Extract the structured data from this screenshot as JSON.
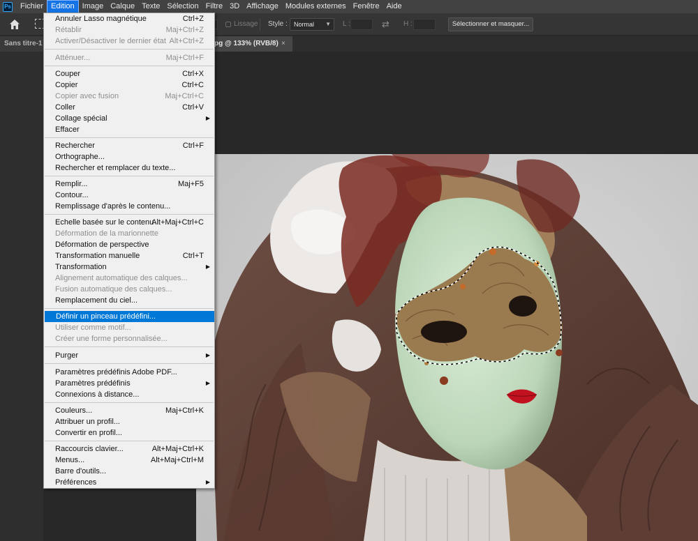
{
  "menubar": {
    "logo": "Ps",
    "items": [
      "Fichier",
      "Edition",
      "Image",
      "Calque",
      "Texte",
      "Sélection",
      "Filtre",
      "3D",
      "Affichage",
      "Modules externes",
      "Fenêtre",
      "Aide"
    ],
    "active": "Edition"
  },
  "options": {
    "lissage_label": "Lissage",
    "style_label": "Style :",
    "style_value": "Normal",
    "width_label": "L :",
    "height_label": "H :",
    "select_mask_button": "Sélectionner et masquer..."
  },
  "tabs": {
    "tab1": "Sans titre-1 @",
    "tab2": "pg @ 133% (RVB/8)",
    "close": "×"
  },
  "edit_menu": {
    "undo": {
      "label": "Annuler Lasso magnétique",
      "shortcut": "Ctrl+Z"
    },
    "redo": {
      "label": "Rétablir",
      "shortcut": "Maj+Ctrl+Z"
    },
    "toggle_last": {
      "label": "Activer/Désactiver le dernier état",
      "shortcut": "Alt+Ctrl+Z"
    },
    "fade": {
      "label": "Atténuer...",
      "shortcut": "Maj+Ctrl+F"
    },
    "cut": {
      "label": "Couper",
      "shortcut": "Ctrl+X"
    },
    "copy": {
      "label": "Copier",
      "shortcut": "Ctrl+C"
    },
    "copy_merged": {
      "label": "Copier avec fusion",
      "shortcut": "Maj+Ctrl+C"
    },
    "paste": {
      "label": "Coller",
      "shortcut": "Ctrl+V"
    },
    "paste_special": {
      "label": "Collage spécial"
    },
    "clear": {
      "label": "Effacer"
    },
    "search": {
      "label": "Rechercher",
      "shortcut": "Ctrl+F"
    },
    "spelling": {
      "label": "Orthographe..."
    },
    "find_replace": {
      "label": "Rechercher et remplacer du texte..."
    },
    "fill": {
      "label": "Remplir...",
      "shortcut": "Maj+F5"
    },
    "stroke": {
      "label": "Contour..."
    },
    "content_aware_fill": {
      "label": "Remplissage d'après le contenu..."
    },
    "content_aware_scale": {
      "label": "Echelle basée sur le contenu",
      "shortcut": "Alt+Maj+Ctrl+C"
    },
    "puppet_warp": {
      "label": "Déformation de la marionnette"
    },
    "perspective_warp": {
      "label": "Déformation de perspective"
    },
    "free_transform": {
      "label": "Transformation manuelle",
      "shortcut": "Ctrl+T"
    },
    "transform": {
      "label": "Transformation"
    },
    "auto_align": {
      "label": "Alignement automatique des calques..."
    },
    "auto_blend": {
      "label": "Fusion automatique des calques..."
    },
    "sky_replace": {
      "label": "Remplacement du ciel..."
    },
    "define_brush": {
      "label": "Définir un pinceau prédéfini..."
    },
    "define_pattern": {
      "label": "Utiliser comme motif..."
    },
    "define_shape": {
      "label": "Créer une forme personnalisée..."
    },
    "purge": {
      "label": "Purger"
    },
    "pdf_presets": {
      "label": "Paramètres prédéfinis Adobe PDF..."
    },
    "presets": {
      "label": "Paramètres prédéfinis"
    },
    "remote": {
      "label": "Connexions à distance..."
    },
    "color_settings": {
      "label": "Couleurs...",
      "shortcut": "Maj+Ctrl+K"
    },
    "assign_profile": {
      "label": "Attribuer un profil..."
    },
    "convert_profile": {
      "label": "Convertir en profil..."
    },
    "keyboard_shortcuts": {
      "label": "Raccourcis clavier...",
      "shortcut": "Alt+Maj+Ctrl+K"
    },
    "menus": {
      "label": "Menus...",
      "shortcut": "Alt+Maj+Ctrl+M"
    },
    "toolbar": {
      "label": "Barre d'outils..."
    },
    "preferences": {
      "label": "Préférences"
    }
  },
  "colors": {
    "menu_highlight": "#0078d7",
    "active_menu_bar": "#1473e6",
    "app_bg": "#282828"
  },
  "icons": [
    "photoshop-logo-icon",
    "home-icon",
    "marquee-tool-icon",
    "swap-icon",
    "chevron-down-icon",
    "submenu-arrow-icon",
    "close-icon"
  ]
}
